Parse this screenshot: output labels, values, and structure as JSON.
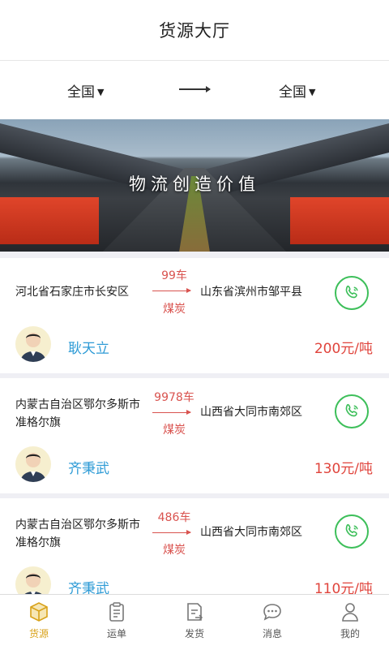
{
  "header": {
    "title": "货源大厅"
  },
  "filter": {
    "from": "全国",
    "to": "全国"
  },
  "banner": {
    "slogan": "物流创造价值"
  },
  "listings": [
    {
      "from": "河北省石家庄市长安区",
      "to": "山东省滨州市邹平县",
      "quantity": "99车",
      "cargo": "煤炭",
      "contact": "耿天立",
      "price": "200元/吨"
    },
    {
      "from": "内蒙古自治区鄂尔多斯市准格尔旗",
      "to": "山西省大同市南郊区",
      "quantity": "9978车",
      "cargo": "煤炭",
      "contact": "齐秉武",
      "price": "130元/吨"
    },
    {
      "from": "内蒙古自治区鄂尔多斯市准格尔旗",
      "to": "山西省大同市南郊区",
      "quantity": "486车",
      "cargo": "煤炭",
      "contact": "齐秉武",
      "price": "110元/吨"
    }
  ],
  "tabs": [
    {
      "label": "货源",
      "icon": "box-icon",
      "active": true
    },
    {
      "label": "运单",
      "icon": "clipboard-icon",
      "active": false
    },
    {
      "label": "发货",
      "icon": "send-form-icon",
      "active": false
    },
    {
      "label": "消息",
      "icon": "chat-bubble-icon",
      "active": false
    },
    {
      "label": "我的",
      "icon": "user-icon",
      "active": false
    }
  ],
  "colors": {
    "accent": "#d8a21a",
    "price": "#e0443c",
    "name": "#2e9bd6",
    "phone": "#3dbf5a",
    "route": "#d9534f"
  }
}
